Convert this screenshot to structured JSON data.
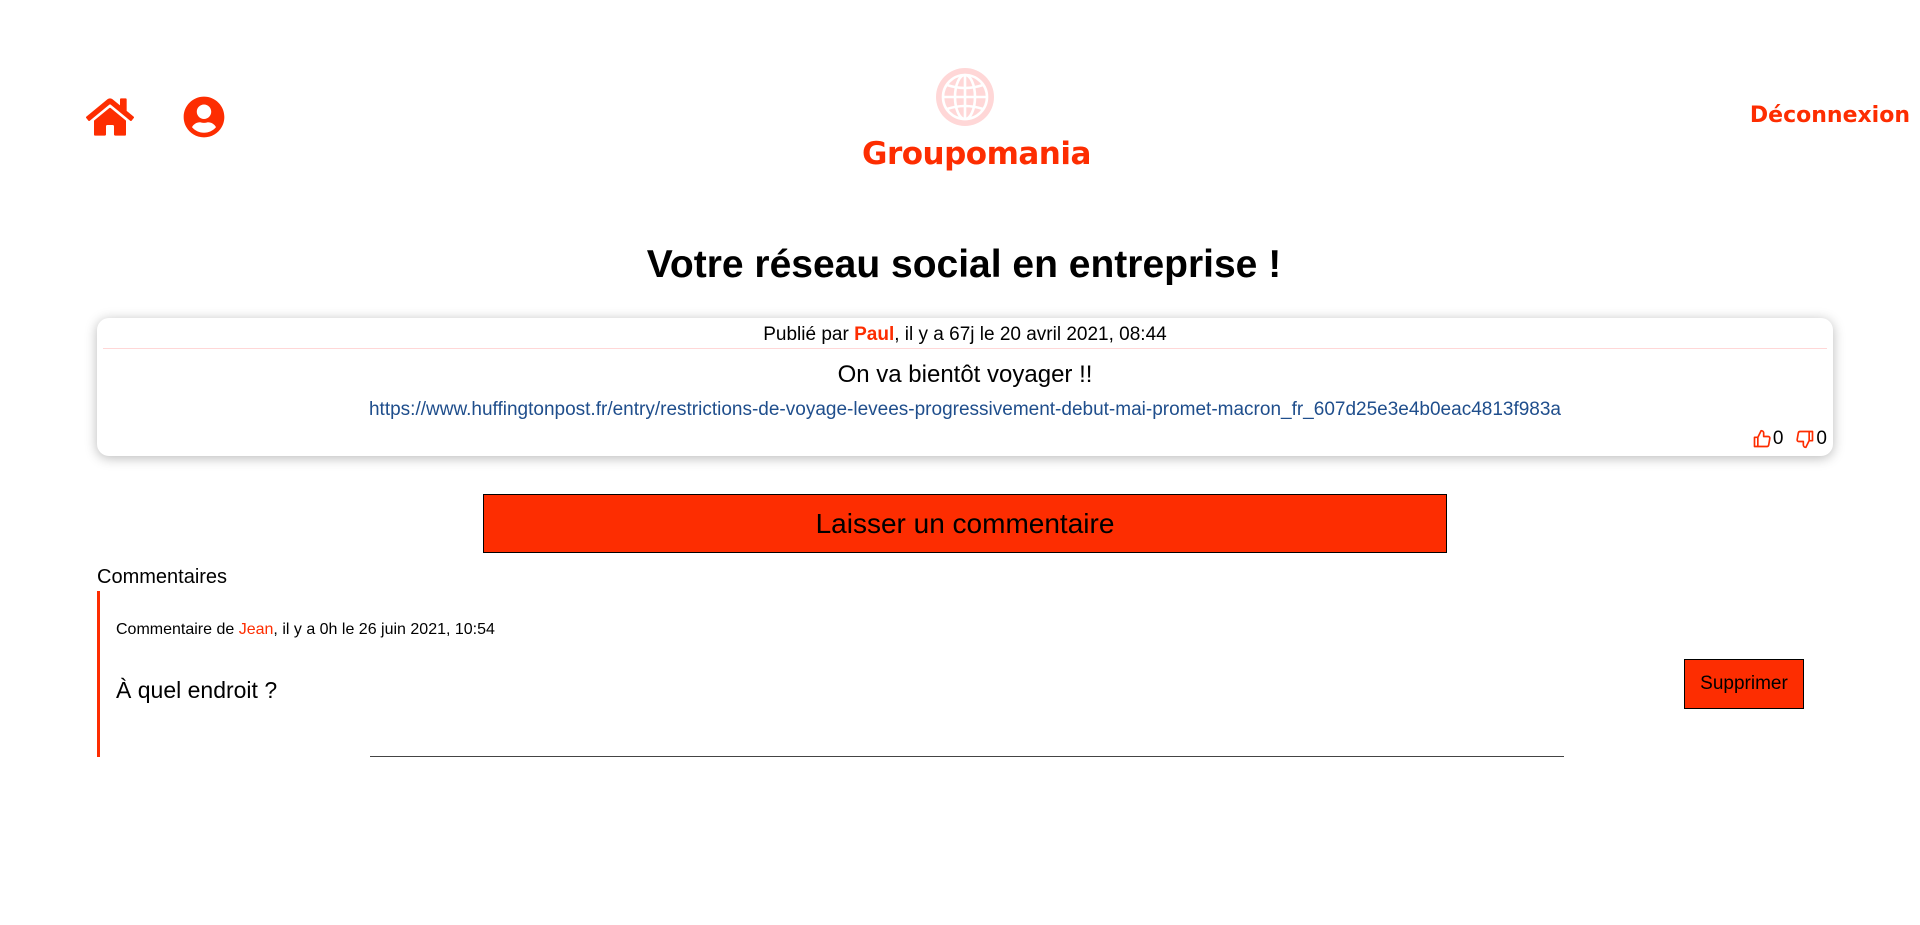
{
  "brand": {
    "name": "Groupomania",
    "accent_color": "#fd2d01",
    "logo_icon": "globe-icon"
  },
  "nav": {
    "home_icon": "home-icon",
    "profile_icon": "user-circle-icon",
    "logout_label": "Déconnexion"
  },
  "page": {
    "title": "Votre réseau social en entreprise !"
  },
  "post": {
    "meta_prefix": "Publié par ",
    "author": "Paul",
    "meta_suffix": ", il y a 67j le 20 avril 2021, 08:44",
    "text": "On va bientôt voyager !!",
    "link": "https://www.huffingtonpost.fr/entry/restrictions-de-voyage-levees-progressivement-debut-mai-promet-macron_fr_607d25e3e4b0eac4813f983a",
    "likes": "0",
    "dislikes": "0"
  },
  "actions": {
    "comment_button_label": "Laisser un commentaire"
  },
  "comments": {
    "heading": "Commentaires",
    "items": [
      {
        "meta_prefix": "Commentaire de ",
        "author": "Jean",
        "meta_suffix": ", il y a 0h le 26 juin 2021, 10:54",
        "text": "À quel endroit ?",
        "delete_label": "Supprimer"
      }
    ]
  }
}
